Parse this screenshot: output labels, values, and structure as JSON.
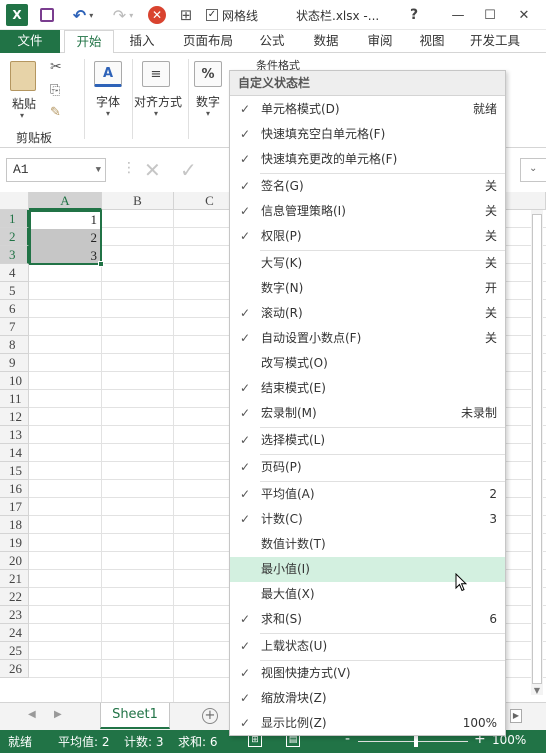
{
  "qat": {
    "logo": "X",
    "gridlines_label": "网格线",
    "gridlines_check": "✓",
    "filename": "状态栏.xlsx -...",
    "help": "?",
    "minimize": "—",
    "restore": "☐",
    "close": "✕",
    "undo": "↶",
    "redo": "↷",
    "clear": "✕"
  },
  "tabs": [
    "文件",
    "开始",
    "插入",
    "页面布局",
    "公式",
    "数据",
    "审阅",
    "视图",
    "开发工具"
  ],
  "ribbon": {
    "paste_label": "粘贴",
    "clipboard_label": "剪贴板",
    "font_label": "字体",
    "align_label": "对齐方式",
    "number_label": "数字",
    "font_icon": "A",
    "number_icon": "%",
    "cond_format_label": "条件格式"
  },
  "namebox": {
    "value": "A1"
  },
  "grid": {
    "columns": [
      "A",
      "B",
      "C"
    ],
    "rows": [
      "1",
      "2",
      "3",
      "4",
      "5",
      "6",
      "7",
      "8",
      "9",
      "10",
      "11",
      "12",
      "13",
      "14",
      "15",
      "16",
      "17",
      "18",
      "19",
      "20",
      "21",
      "22",
      "23",
      "24",
      "25",
      "26"
    ],
    "cells": [
      "1",
      "2",
      "3"
    ]
  },
  "sheet_tab": "Sheet1",
  "add_sheet": "+",
  "status": {
    "ready": "就绪",
    "average": "平均值: 2",
    "count": "计数: 3",
    "sum": "求和: 6",
    "zoom": "100%",
    "zoom_minus": "-",
    "zoom_plus": "+"
  },
  "menu": {
    "title": "自定义状态栏",
    "items": [
      {
        "label": "单元格模式(D)",
        "value": "就绪",
        "checked": "✓"
      },
      {
        "label": "快速填充空白单元格(F)",
        "value": "",
        "checked": "✓"
      },
      {
        "label": "快速填充更改的单元格(F)",
        "value": "",
        "checked": "✓"
      },
      {
        "label": "签名(G)",
        "value": "关",
        "checked": "✓"
      },
      {
        "label": "信息管理策略(I)",
        "value": "关",
        "checked": "✓"
      },
      {
        "label": "权限(P)",
        "value": "关",
        "checked": "✓"
      },
      {
        "label": "大写(K)",
        "value": "关",
        "checked": ""
      },
      {
        "label": "数字(N)",
        "value": "开",
        "checked": ""
      },
      {
        "label": "滚动(R)",
        "value": "关",
        "checked": "✓"
      },
      {
        "label": "自动设置小数点(F)",
        "value": "关",
        "checked": "✓"
      },
      {
        "label": "改写模式(O)",
        "value": "",
        "checked": ""
      },
      {
        "label": "结束模式(E)",
        "value": "",
        "checked": "✓"
      },
      {
        "label": "宏录制(M)",
        "value": "未录制",
        "checked": "✓"
      },
      {
        "label": "选择模式(L)",
        "value": "",
        "checked": "✓"
      },
      {
        "label": "页码(P)",
        "value": "",
        "checked": "✓"
      },
      {
        "label": "平均值(A)",
        "value": "2",
        "checked": "✓"
      },
      {
        "label": "计数(C)",
        "value": "3",
        "checked": "✓"
      },
      {
        "label": "数值计数(T)",
        "value": "",
        "checked": ""
      },
      {
        "label": "最小值(I)",
        "value": "",
        "checked": ""
      },
      {
        "label": "最大值(X)",
        "value": "",
        "checked": ""
      },
      {
        "label": "求和(S)",
        "value": "6",
        "checked": "✓"
      },
      {
        "label": "上载状态(U)",
        "value": "",
        "checked": "✓"
      },
      {
        "label": "视图快捷方式(V)",
        "value": "",
        "checked": "✓"
      },
      {
        "label": "缩放滑块(Z)",
        "value": "",
        "checked": "✓"
      },
      {
        "label": "显示比例(Z)",
        "value": "100%",
        "checked": "✓"
      }
    ]
  }
}
